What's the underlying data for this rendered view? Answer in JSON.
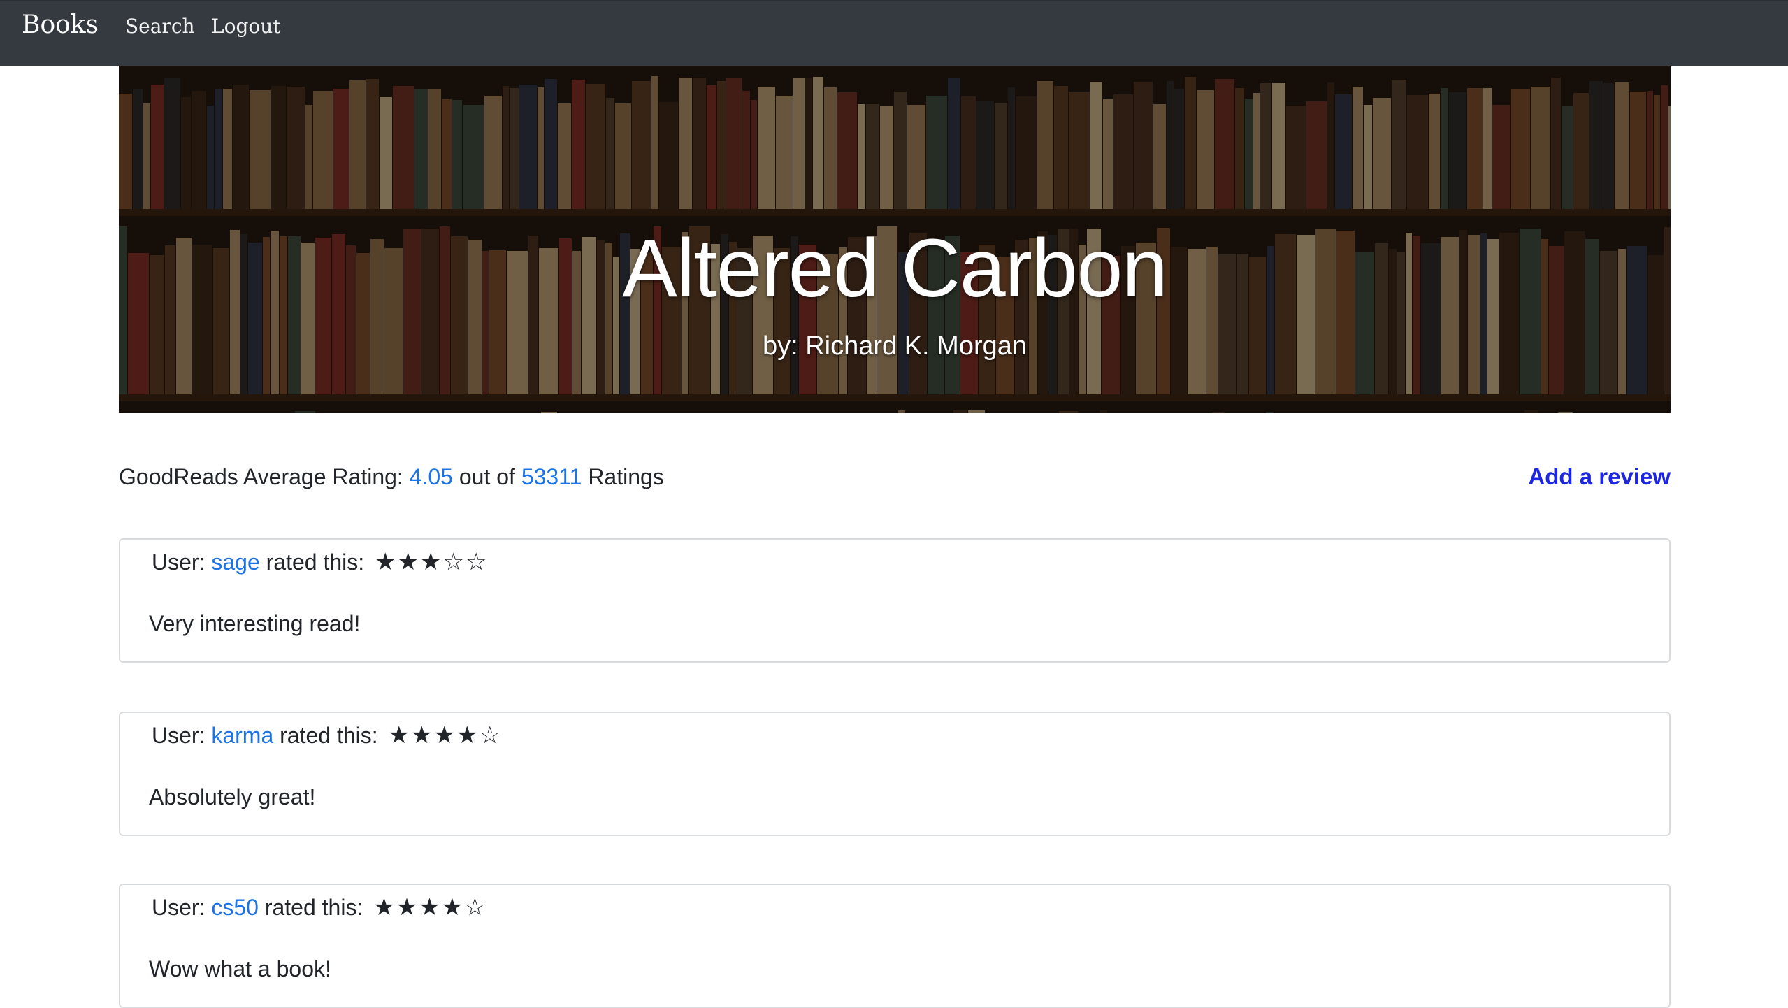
{
  "navbar": {
    "brand": "Books",
    "links": [
      "Search",
      "Logout"
    ]
  },
  "book": {
    "title": "Altered Carbon",
    "author_line": "by: Richard K. Morgan"
  },
  "goodreads": {
    "label": "GoodReads Average Rating:",
    "average": "4.05",
    "out_of_label": "out of",
    "count": "53311",
    "ratings_label": "Ratings"
  },
  "add_review_label": "Add a review",
  "reviews": [
    {
      "user_label": "User:",
      "username": "sage",
      "rated_label": "rated this:",
      "rating": 3,
      "stars": "★★★☆☆",
      "text": "Very interesting read!"
    },
    {
      "user_label": "User:",
      "username": "karma",
      "rated_label": "rated this:",
      "rating": 4,
      "stars": "★★★★☆",
      "text": "Absolutely great!"
    },
    {
      "user_label": "User:",
      "username": "cs50",
      "rated_label": "rated this:",
      "rating": 4,
      "stars": "★★★★☆",
      "text": "Wow what a book!"
    }
  ],
  "colors": {
    "navbar_bg": "#343a40",
    "link_blue": "#1a73e8",
    "add_review_blue": "#1c26e0"
  }
}
